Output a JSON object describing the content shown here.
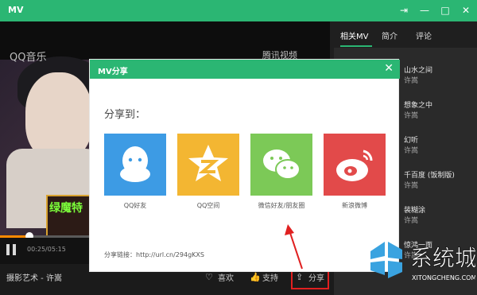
{
  "window": {
    "title": "MV",
    "controls": [
      "pin-icon",
      "minimize-icon",
      "maximize-icon",
      "close-icon"
    ]
  },
  "video": {
    "logo_left": "QQ音乐",
    "logo_right": "腾讯视频",
    "banner_text": "绿魔特",
    "progress": 0.09,
    "time": "00:25/05:15"
  },
  "bottom": {
    "song": "摄影艺术 - 许嵩",
    "like_label": "喜欢",
    "support_label": "支持",
    "share_label": "分享"
  },
  "sidepanel": {
    "tabs": [
      "相关MV",
      "简介",
      "评论"
    ],
    "active_tab": 0,
    "items": [
      {
        "title": "山水之间",
        "artist": "许嵩"
      },
      {
        "title": "想象之中",
        "artist": "许嵩"
      },
      {
        "title": "幻听",
        "artist": "许嵩"
      },
      {
        "title": "千百度 (饭制版)",
        "artist": "许嵩"
      },
      {
        "title": "装糊涂",
        "artist": "许嵩"
      },
      {
        "title": "惊鸿一面",
        "artist": "许嵩"
      }
    ]
  },
  "modal": {
    "title": "MV分享",
    "share_to": "分享到：",
    "targets": [
      {
        "label": "QQ好友",
        "color": "#3d9be4",
        "icon": "qq-icon"
      },
      {
        "label": "QQ空间",
        "color": "#f3b632",
        "icon": "qzone-star-icon"
      },
      {
        "label": "微信好友/朋友圈",
        "color": "#7cc957",
        "icon": "wechat-icon"
      },
      {
        "label": "新浪微博",
        "color": "#e24a4a",
        "icon": "weibo-icon"
      }
    ],
    "share_link": "分享链接：http://url.cn/294gKXS"
  },
  "watermark": {
    "text": "系统城",
    "url": "XITONGCHENG.COM"
  },
  "colors": {
    "brand_green": "#2bb673",
    "highlight_red": "#e02020",
    "progress_orange": "#ff8a00"
  }
}
